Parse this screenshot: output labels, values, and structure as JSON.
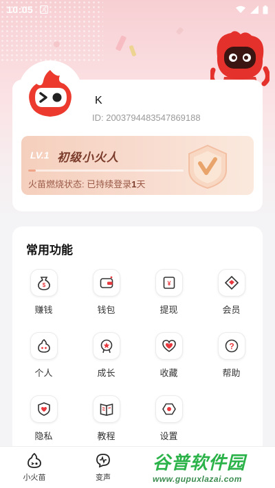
{
  "status_bar": {
    "time": "10:05",
    "icon": "A"
  },
  "profile": {
    "username": "K",
    "id_text": "ID: 2003794483547869188"
  },
  "level": {
    "tag": "LV.1",
    "title": "初级小火人",
    "status_prefix": "火苗燃烧状态: 已持续登录",
    "status_days": "1",
    "status_suffix": "天",
    "progress": 0.05
  },
  "functions": {
    "title": "常用功能",
    "items": [
      {
        "label": "赚钱",
        "icon": "money-bag-icon"
      },
      {
        "label": "钱包",
        "icon": "wallet-icon"
      },
      {
        "label": "提现",
        "icon": "withdraw-icon"
      },
      {
        "label": "会员",
        "icon": "vip-diamond-icon"
      },
      {
        "label": "个人",
        "icon": "flame-face-icon"
      },
      {
        "label": "成长",
        "icon": "medal-icon"
      },
      {
        "label": "收藏",
        "icon": "heart-icon"
      },
      {
        "label": "帮助",
        "icon": "question-icon"
      },
      {
        "label": "隐私",
        "icon": "shield-heart-icon"
      },
      {
        "label": "教程",
        "icon": "book-icon"
      },
      {
        "label": "设置",
        "icon": "gear-icon"
      }
    ]
  },
  "tabbar": {
    "tabs": [
      {
        "label": "小火苗",
        "icon": "flame-icon"
      },
      {
        "label": "变声",
        "icon": "voice-change-icon"
      }
    ]
  },
  "watermark": {
    "main": "谷普软件园",
    "sub": "www.gupuxlazai.com"
  },
  "colors": {
    "accent": "#e8383d",
    "banner_text": "#7a3b2a",
    "watermark": "#2bb34a"
  }
}
